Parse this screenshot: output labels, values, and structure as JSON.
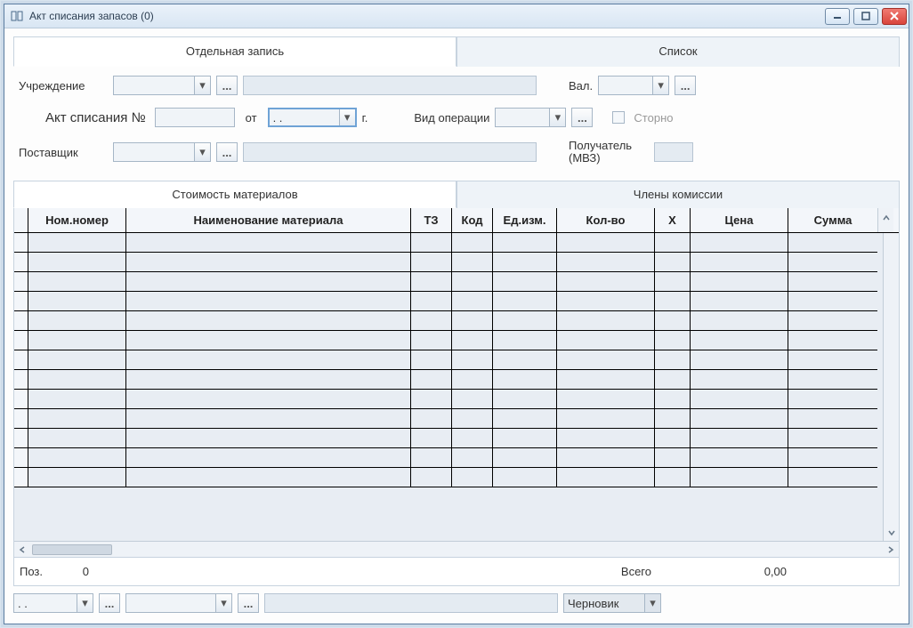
{
  "window": {
    "title": "Акт списания запасов (0)"
  },
  "top_tabs": {
    "single": "Отдельная запись",
    "list": "Список"
  },
  "labels": {
    "institution": "Учреждение",
    "currency": "Вал.",
    "act_number": "Акт списания №",
    "from": "от",
    "year_suffix": "г.",
    "op_type": "Вид операции",
    "storno": "Сторно",
    "supplier": "Поставщик",
    "recipient": "Получатель (МВЗ)"
  },
  "fields": {
    "institution": "",
    "institution_name": "",
    "currency": "",
    "act_number": "",
    "date": ".  .",
    "op_type": "",
    "storno_checked": false,
    "supplier": "",
    "supplier_name": "",
    "recipient": ""
  },
  "sub_tabs": {
    "materials": "Стоимость материалов",
    "commission": "Члены комиссии"
  },
  "grid_headers": {
    "nom": "Ном.номер",
    "name": "Наименование материала",
    "tz": "ТЗ",
    "kod": "Код",
    "ed": "Ед.изм.",
    "kol": "Кол-во",
    "x": "Х",
    "price": "Цена",
    "sum": "Сумма"
  },
  "grid_rows": [],
  "footer": {
    "pos_label": "Поз.",
    "pos_value": "0",
    "total_label": "Всего",
    "total_value": "0,00"
  },
  "bottom": {
    "date": ".  .",
    "combo2": "",
    "text": "",
    "status": "Черновик"
  },
  "dots": "..."
}
